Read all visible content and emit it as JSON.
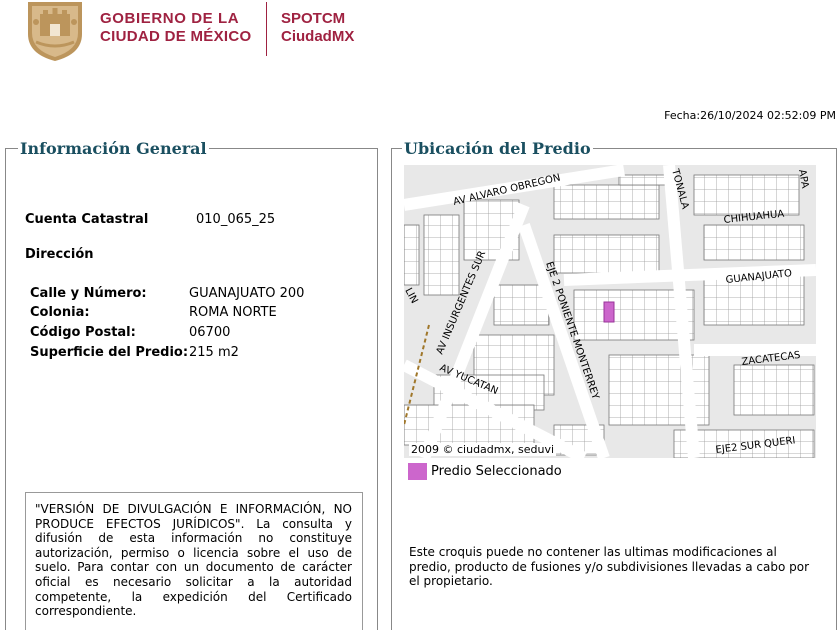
{
  "header": {
    "gov_line1": "GOBIERNO DE LA",
    "gov_line2": "CIUDAD DE MÉXICO",
    "app_line1": "SPOTCM",
    "app_line2": "CiudadMX",
    "brand_color": "#9f2241",
    "logo_icon": "cdmx-coat-of-arms-icon"
  },
  "fecha": "Fecha:26/10/2024 02:52:09 PM",
  "info": {
    "legend": "Información General",
    "cuenta_label": "Cuenta Catastral",
    "cuenta_value": "010_065_25",
    "direccion_label": "Dirección",
    "calle_label": "Calle y Número:",
    "calle_value": "GUANAJUATO 200",
    "colonia_label": "Colonia:",
    "colonia_value": "ROMA NORTE",
    "cp_label": "Código Postal:",
    "cp_value": "06700",
    "superficie_label": "Superficie del Predio:",
    "superficie_value": "215 m2",
    "disclaimer": "\"VERSIÓN DE DIVULGACIÓN E INFORMACIÓN, NO PRODUCE EFECTOS JURÍDICOS\". La consulta y difusión de esta información no constituye autorización, permiso o licencia sobre el uso de suelo. Para contar con un documento de carácter oficial es necesario solicitar a la autoridad competente, la expedición del Certificado correspondiente."
  },
  "ubicacion": {
    "legend": "Ubicación del Predio",
    "streets": [
      "AV ALVARO OBREGON",
      "TONALA",
      "APA",
      "CHIHUAHUA",
      "GUANAJUATO",
      "AV INSURGENTES SUR",
      "EJE 2 PONIENTE MONTERREY",
      "AV YUCATAN",
      "ZACATECAS",
      "EJE2 SUR QUERI",
      "LIN"
    ],
    "credit": "2009 © ciudadmx, seduvi",
    "legend_label": "Predio Seleccionado",
    "legend_color": "#cc66cc",
    "note": "Este croquis puede no contener las ultimas modificaciones al predio, producto de fusiones y/o subdivisiones llevadas a cabo por el propietario."
  }
}
